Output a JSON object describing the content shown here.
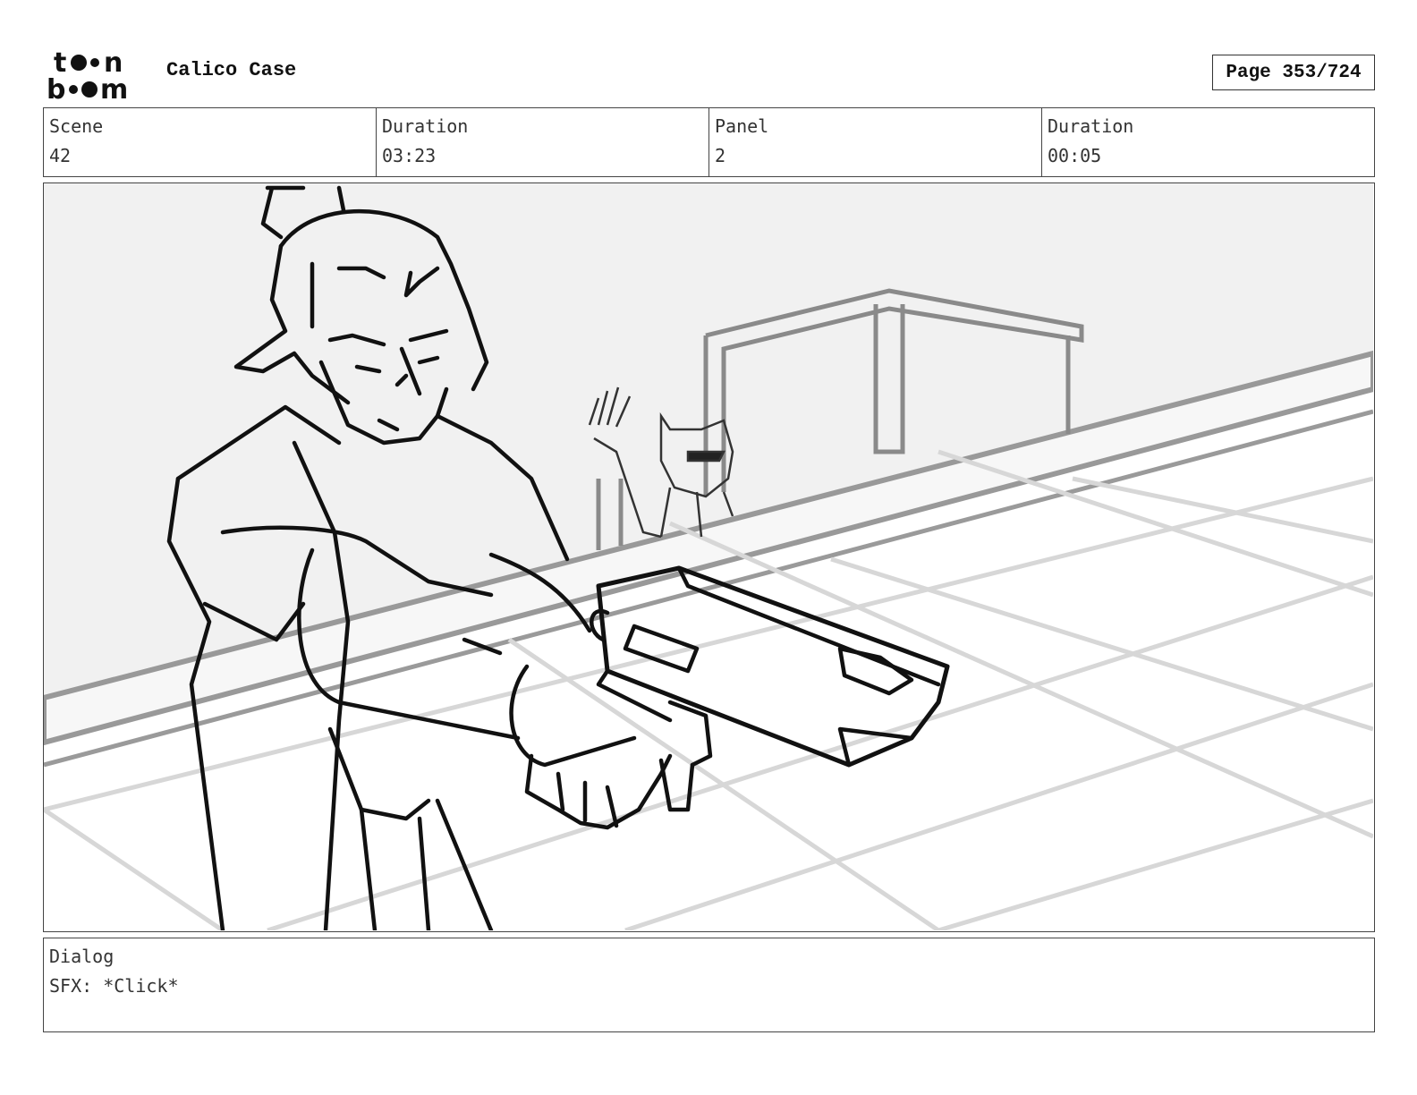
{
  "header": {
    "logo_text": "toon boom",
    "project_title": "Calico Case",
    "page_label": "Page 353/724"
  },
  "info": [
    {
      "label": "Scene",
      "value": "42"
    },
    {
      "label": "Duration",
      "value": "03:23"
    },
    {
      "label": "Panel",
      "value": "2"
    },
    {
      "label": "Duration",
      "value": "00:05"
    }
  ],
  "dialog": {
    "label": "Dialog",
    "text": "SFX: *Click*"
  }
}
